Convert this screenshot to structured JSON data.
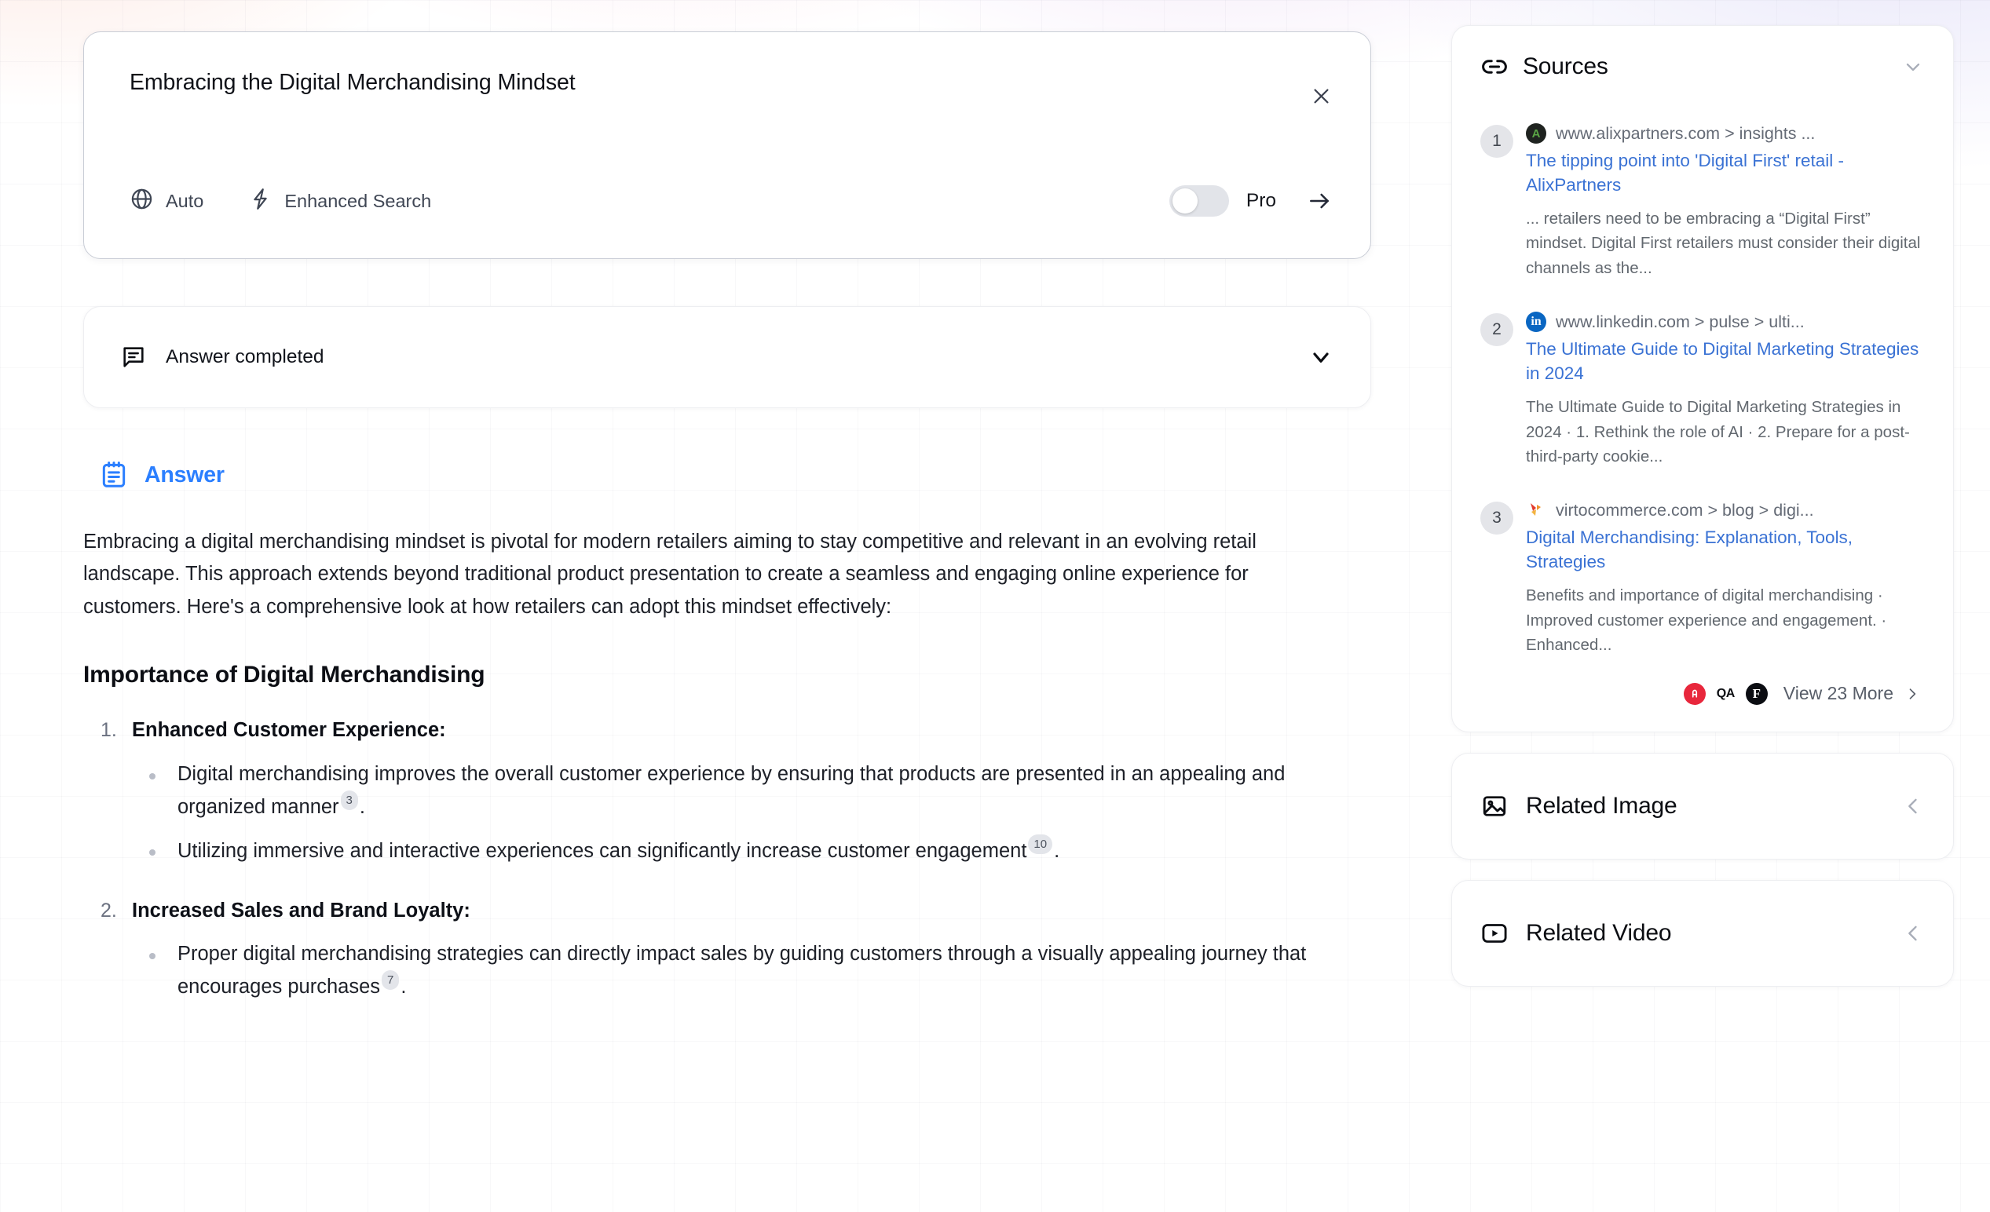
{
  "search": {
    "query": "Embracing the Digital Merchandising Mindset",
    "close_label": "close-icon",
    "mode_label": "Auto",
    "enhanced_label": "Enhanced Search",
    "pro_label": "Pro",
    "pro_enabled": false,
    "submit_label": "submit-arrow"
  },
  "status": {
    "text": "Answer completed"
  },
  "answer": {
    "heading": "Answer",
    "intro": "Embracing a digital merchandising mindset is pivotal for modern retailers aiming to stay competitive and relevant in an evolving retail landscape. This approach extends beyond traditional product presentation to create a seamless and engaging online experience for customers. Here's a comprehensive look at how retailers can adopt this mindset effectively:",
    "section_heading": "Importance of Digital Merchandising",
    "items": [
      {
        "title": "Enhanced Customer Experience:",
        "bullets": [
          {
            "text_before": "Digital merchandising improves the overall customer experience by ensuring that products are presented in an appealing and organized manner",
            "citation": "3",
            "text_after": "."
          },
          {
            "text_before": "Utilizing immersive and interactive experiences can significantly increase customer engagement",
            "citation": "10",
            "text_after": "."
          }
        ]
      },
      {
        "title": "Increased Sales and Brand Loyalty:",
        "bullets": [
          {
            "text_before": "Proper digital merchandising strategies can directly impact sales by guiding customers through a visually appealing journey that encourages purchases",
            "citation": "7",
            "text_after": "."
          }
        ]
      }
    ]
  },
  "sources": {
    "title": "Sources",
    "items": [
      {
        "num": "1",
        "favicon_letter": "A",
        "url": "www.alixpartners.com > insights ...",
        "title": "The tipping point into 'Digital First' retail - AlixPartners",
        "snippet": "... retailers need to be embracing a “Digital First” mindset. Digital First retailers must consider their digital channels as the..."
      },
      {
        "num": "2",
        "favicon_letter": "in",
        "url": "www.linkedin.com > pulse > ulti...",
        "title": "The Ultimate Guide to Digital Marketing Strategies in 2024",
        "snippet": "The Ultimate Guide to Digital Marketing Strategies in 2024 · 1. Rethink the role of AI · 2. Prepare for a post-third-party cookie..."
      },
      {
        "num": "3",
        "favicon_letter": "",
        "url": "virtocommerce.com > blog > digi...",
        "title": "Digital Merchandising: Explanation, Tools, Strategies",
        "snippet": "Benefits and importance of digital merchandising · Improved customer experience and engagement. · Enhanced..."
      }
    ],
    "more_label": "View 23 More",
    "more_favicons": [
      "red-circle-icon",
      "QA",
      "F"
    ]
  },
  "related": {
    "image_label": "Related Image",
    "video_label": "Related Video"
  },
  "colors": {
    "accent_blue": "#2b7fff",
    "link_blue": "#3a72d4",
    "muted": "#656b76"
  }
}
